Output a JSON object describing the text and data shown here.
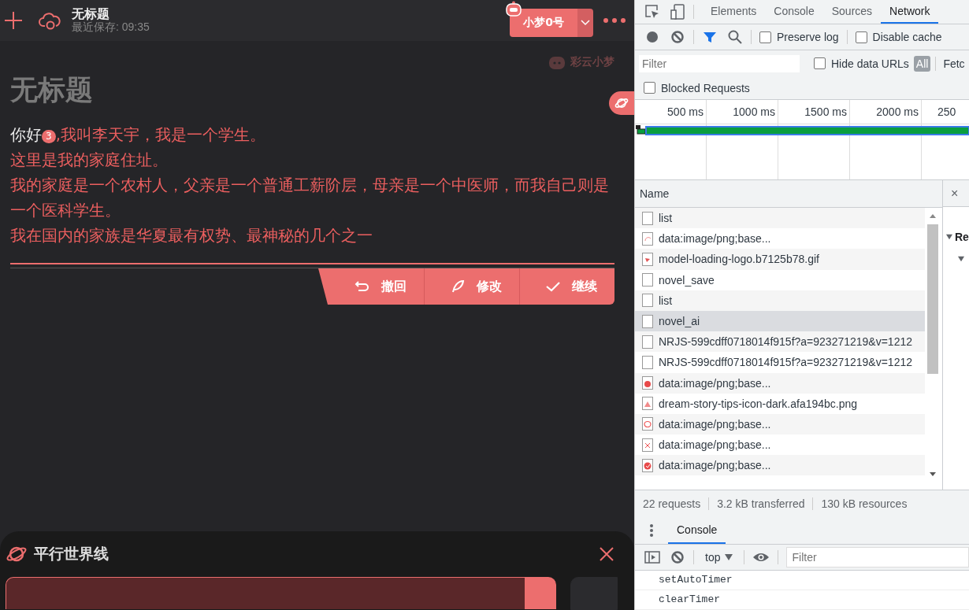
{
  "editor": {
    "header": {
      "title": "无标题",
      "saved": "最近保存: 09:35",
      "model": "小梦0号"
    },
    "brand": "彩云小梦",
    "doc_title": "无标题",
    "story": {
      "prefix": "你好",
      "badge": "3",
      "lines": [
        ",我叫李天宇，我是一个学生。",
        "这里是我的家庭住址。",
        "我的家庭是一个农村人，父亲是一个普通工薪阶层，母亲是一个中医师，而我自己则是一个医科学生。",
        "我在国内的家族是华夏最有权势、最神秘的几个之一"
      ]
    },
    "actions": [
      {
        "label": "撤回",
        "kind": "undo"
      },
      {
        "label": "修改",
        "kind": "edit"
      },
      {
        "label": "继续",
        "kind": "continue"
      }
    ],
    "panel": {
      "title": "平行世界线",
      "cards": [
        {
          "selected": true
        },
        {
          "selected": false
        }
      ]
    }
  },
  "devtools": {
    "tabs": [
      {
        "label": "Elements",
        "selected": false
      },
      {
        "label": "Console",
        "selected": false
      },
      {
        "label": "Sources",
        "selected": false
      },
      {
        "label": "Network",
        "selected": true
      }
    ],
    "preserve_log": {
      "label": "Preserve log",
      "checked": false
    },
    "disable_cache": {
      "label": "Disable cache",
      "checked": false
    },
    "filter": {
      "placeholder": "Filter"
    },
    "hide_data_urls": {
      "label": "Hide data URLs",
      "checked": false
    },
    "type_filters": [
      {
        "label": "All",
        "selected": true
      },
      {
        "label": "Fetc",
        "selected": false
      }
    ],
    "blocked_requests": {
      "label": "Blocked Requests",
      "checked": false
    },
    "timeline_ticks": [
      "500 ms",
      "1000 ms",
      "1500 ms",
      "2000 ms",
      "250"
    ],
    "table": {
      "column": "Name",
      "rows": [
        {
          "name": "list",
          "kind": "blank",
          "selected": false
        },
        {
          "name": "data:image/png;base...",
          "kind": "spinner",
          "selected": false
        },
        {
          "name": "model-loading-logo.b7125b78.gif",
          "kind": "gif",
          "selected": false
        },
        {
          "name": "novel_save",
          "kind": "blank",
          "selected": false
        },
        {
          "name": "list",
          "kind": "blank",
          "selected": false
        },
        {
          "name": "novel_ai",
          "kind": "blank",
          "selected": true
        },
        {
          "name": "NRJS-599cdff0718014f915f?a=923271219&v=1212",
          "kind": "blank",
          "selected": false
        },
        {
          "name": "NRJS-599cdff0718014f915f?a=923271219&v=1212",
          "kind": "blank",
          "selected": false
        },
        {
          "name": "data:image/png;base...",
          "kind": "blob",
          "selected": false
        },
        {
          "name": "dream-story-tips-icon-dark.afa194bc.png",
          "kind": "tips",
          "selected": false
        },
        {
          "name": "data:image/png;base...",
          "kind": "planet",
          "selected": false
        },
        {
          "name": "data:image/png;base...",
          "kind": "cross",
          "selected": false
        },
        {
          "name": "data:image/png;base...",
          "kind": "check",
          "selected": false
        }
      ]
    },
    "side_panel": {
      "close": "×",
      "section": "Re"
    },
    "summary": [
      "22 requests",
      "3.2 kB transferred",
      "130 kB resources"
    ],
    "drawer": {
      "tab": {
        "label": "Console",
        "selected": true
      },
      "context": "top",
      "filter": {
        "placeholder": "Filter"
      },
      "messages": [
        "setAutoTimer",
        "clearTimer"
      ]
    }
  }
}
